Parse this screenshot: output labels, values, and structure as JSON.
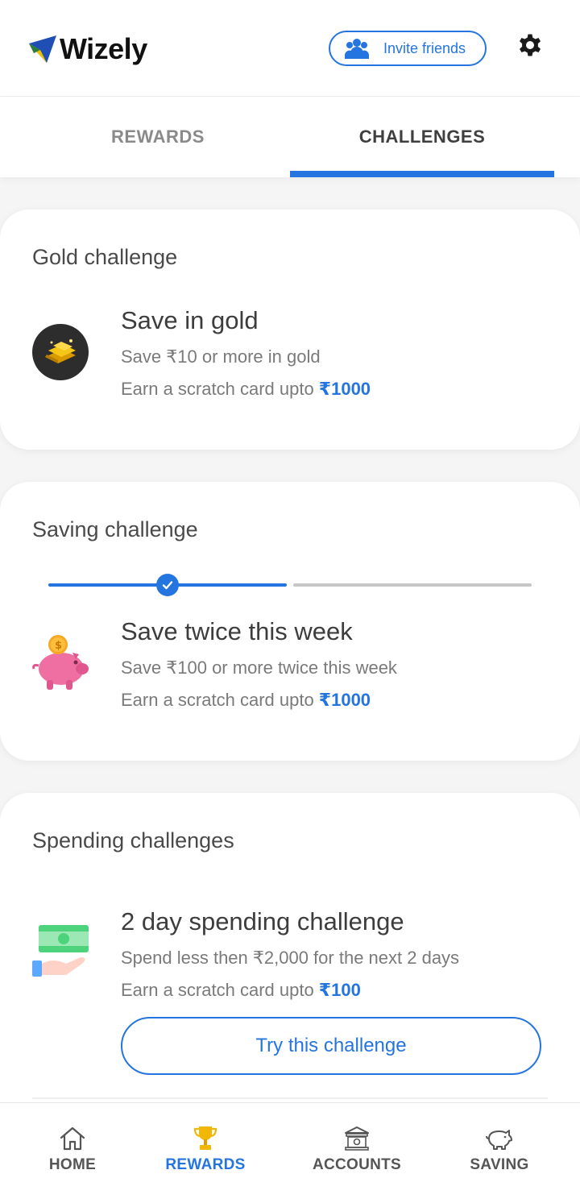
{
  "header": {
    "brand": "Wizely",
    "invite_label": "Invite friends"
  },
  "tabs": [
    {
      "label": "REWARDS",
      "active": false
    },
    {
      "label": "CHALLENGES",
      "active": true
    }
  ],
  "gold_card": {
    "title": "Gold challenge",
    "challenge_title": "Save in gold",
    "description": "Save ₹10 or more in gold",
    "earn_prefix": "Earn a scratch card upto ",
    "earn_amount": "₹1000"
  },
  "saving_card": {
    "title": "Saving challenge",
    "progress_completed": 1,
    "progress_total": 2,
    "challenge_title": "Save twice this week",
    "description": "Save ₹100 or more twice this week",
    "earn_prefix": "Earn a scratch card upto ",
    "earn_amount": "₹1000"
  },
  "spending_card": {
    "title": "Spending challenges",
    "challenge_title": "2 day spending challenge",
    "description": "Spend less then ₹2,000 for the next 2 days",
    "earn_prefix": "Earn a scratch card upto ",
    "earn_amount": "₹100",
    "button_label": "Try this challenge"
  },
  "bottom_nav": [
    {
      "label": "HOME",
      "icon": "home-icon",
      "active": false
    },
    {
      "label": "REWARDS",
      "icon": "trophy-icon",
      "active": true
    },
    {
      "label": "ACCOUNTS",
      "icon": "bank-icon",
      "active": false
    },
    {
      "label": "SAVING",
      "icon": "piggy-bank-icon",
      "active": false
    }
  ],
  "colors": {
    "accent": "#2575e0",
    "gold": "#f2b705",
    "piggy": "#f06fa3"
  }
}
